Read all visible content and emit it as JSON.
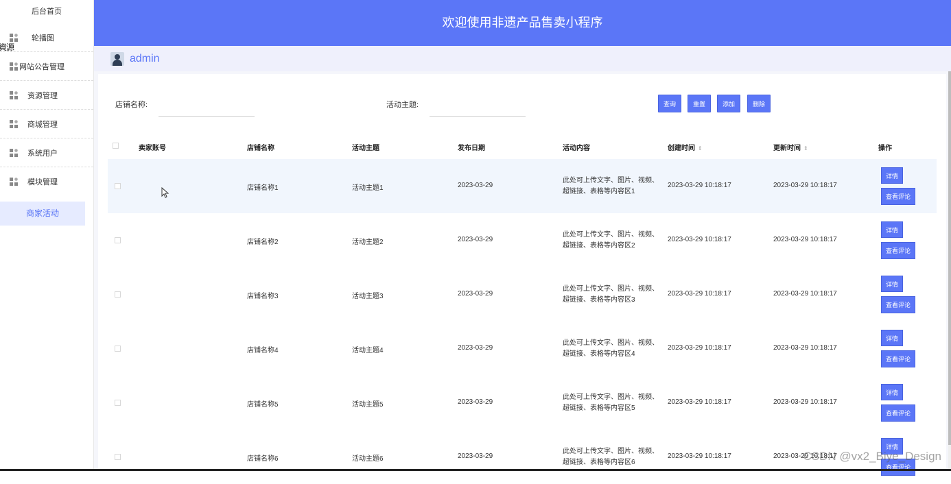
{
  "sidebar": {
    "home": "后台首页",
    "items": [
      {
        "label": "轮播图",
        "icon": "grid-icon"
      },
      {
        "label": "网站公告管理",
        "icon": "grid-icon"
      },
      {
        "label": "资源管理",
        "icon": "grid-icon"
      },
      {
        "label": "商城管理",
        "icon": "grid-icon"
      },
      {
        "label": "系统用户",
        "icon": "grid-icon"
      },
      {
        "label": "模块管理",
        "icon": "grid-icon"
      }
    ],
    "overlay_text": "資源",
    "active": "商家活动"
  },
  "header": {
    "title": "欢迎使用非遗产品售卖小程序"
  },
  "userbar": {
    "username": "admin"
  },
  "search": {
    "shop_label": "店铺名称:",
    "shop_value": "",
    "topic_label": "活动主题:",
    "topic_value": "",
    "buttons": {
      "query": "查询",
      "reset": "重置",
      "add": "添加",
      "delete": "删除"
    }
  },
  "table": {
    "columns": [
      "卖家账号",
      "店铺名称",
      "活动主题",
      "发布日期",
      "活动内容",
      "创建时间",
      "更新时间",
      "操作"
    ],
    "rows": [
      {
        "seller": "",
        "shop": "店铺名称1",
        "topic": "活动主题1",
        "date": "2023-03-29",
        "content_l1": "此处可上传文字、图片、视频、",
        "content_l2": "超链接、表格等内容区1",
        "created": "2023-03-29 10:18:17",
        "updated": "2023-03-29 10:18:17"
      },
      {
        "seller": "",
        "shop": "店铺名称2",
        "topic": "活动主题2",
        "date": "2023-03-29",
        "content_l1": "此处可上传文字、图片、视频、",
        "content_l2": "超链接、表格等内容区2",
        "created": "2023-03-29 10:18:17",
        "updated": "2023-03-29 10:18:17"
      },
      {
        "seller": "",
        "shop": "店铺名称3",
        "topic": "活动主题3",
        "date": "2023-03-29",
        "content_l1": "此处可上传文字、图片、视频、",
        "content_l2": "超链接、表格等内容区3",
        "created": "2023-03-29 10:18:17",
        "updated": "2023-03-29 10:18:17"
      },
      {
        "seller": "",
        "shop": "店铺名称4",
        "topic": "活动主题4",
        "date": "2023-03-29",
        "content_l1": "此处可上传文字、图片、视频、",
        "content_l2": "超链接、表格等内容区4",
        "created": "2023-03-29 10:18:17",
        "updated": "2023-03-29 10:18:17"
      },
      {
        "seller": "",
        "shop": "店铺名称5",
        "topic": "活动主题5",
        "date": "2023-03-29",
        "content_l1": "此处可上传文字、图片、视频、",
        "content_l2": "超链接、表格等内容区5",
        "created": "2023-03-29 10:18:17",
        "updated": "2023-03-29 10:18:17"
      },
      {
        "seller": "",
        "shop": "店铺名称6",
        "topic": "活动主题6",
        "date": "2023-03-29",
        "content_l1": "此处可上传文字、图片、视频、",
        "content_l2": "超链接、表格等内容区6",
        "created": "2023-03-29 10:18:17",
        "updated": "2023-03-29 10:18:17"
      }
    ],
    "detail_label": "详情",
    "review_label": "查看评论"
  },
  "watermark": "CSDN @vx2_Biye_Design",
  "colors": {
    "primary": "#5b76f7",
    "header_bg": "#5b76f7",
    "userbar_bg": "#eff0fc",
    "active_bg": "#e6ebff",
    "row_highlight": "#f1f6fd"
  }
}
